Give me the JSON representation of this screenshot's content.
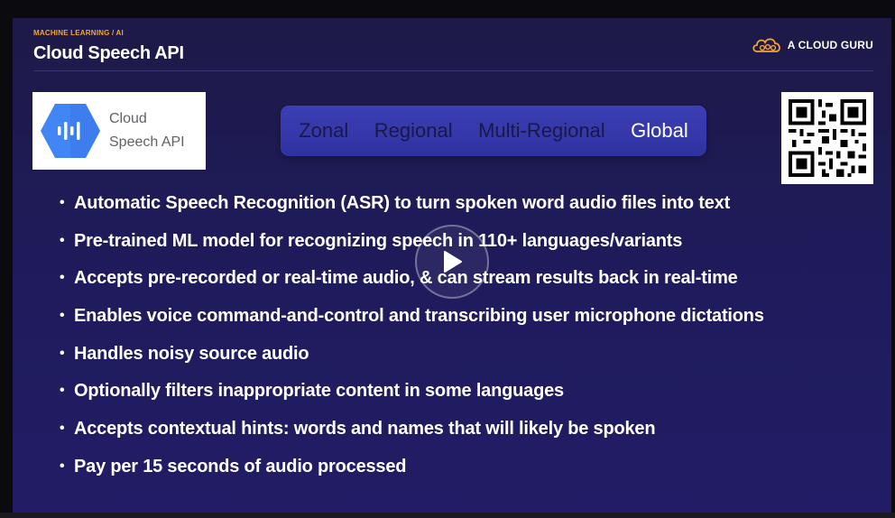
{
  "slide": {
    "eyebrow": "MACHINE LEARNING / AI",
    "title": "Cloud Speech API",
    "brand": "A CLOUD GURU"
  },
  "product": {
    "name_line1": "Cloud",
    "name_line2": "Speech API",
    "icon": "speech-waveform-hexagon-icon",
    "accent": "#4285f4"
  },
  "regions": {
    "items": [
      "Zonal",
      "Regional",
      "Multi-Regional",
      "Global"
    ],
    "active": "Global"
  },
  "bullets": [
    "Automatic Speech Recognition (ASR) to turn spoken word audio files into text",
    "Pre-trained ML model for recognizing speech in 110+ languages/variants",
    "Accepts pre-recorded or real-time audio, & can stream results back in real-time",
    "Enables voice command-and-control and transcribing user microphone dictations",
    "Handles noisy source audio",
    "Optionally filters inappropriate content in some languages",
    "Accepts contextual hints: words and names that will likely be spoken",
    "Pay per 15 seconds of audio processed"
  ],
  "colors": {
    "eyebrow": "#f6a531",
    "slide_bg": "#1f1b5a",
    "region_bar": "#3b3fb4"
  },
  "icons": {
    "brand": "cloud-logo-icon",
    "play": "play-icon",
    "qr": "qr-code-icon"
  }
}
